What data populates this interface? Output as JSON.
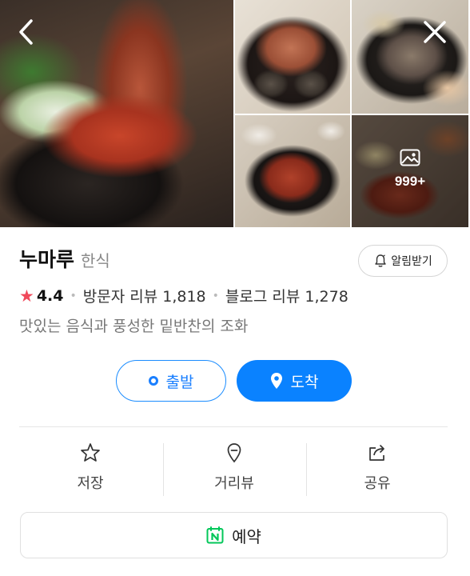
{
  "gallery": {
    "more_count": "999+",
    "icons": {
      "back": "chevron-left-icon",
      "close": "close-icon",
      "more": "image-icon"
    }
  },
  "place": {
    "name": "누마루",
    "category": "한식",
    "notify_label": "알림받기",
    "rating": "4.4",
    "visitor_reviews_label": "방문자 리뷰 1,818",
    "blog_reviews_label": "블로그 리뷰 1,278",
    "description": "맛있는 음식과 풍성한 밑반찬의 조화"
  },
  "route": {
    "start_label": "출발",
    "arrive_label": "도착",
    "accent": "#0a82ff"
  },
  "actions": [
    {
      "label": "저장",
      "icon": "star-outline-icon"
    },
    {
      "label": "거리뷰",
      "icon": "location-pin-icon"
    },
    {
      "label": "공유",
      "icon": "share-icon"
    }
  ],
  "reservation": {
    "label": "예약",
    "badge_color": "#03c75a"
  }
}
